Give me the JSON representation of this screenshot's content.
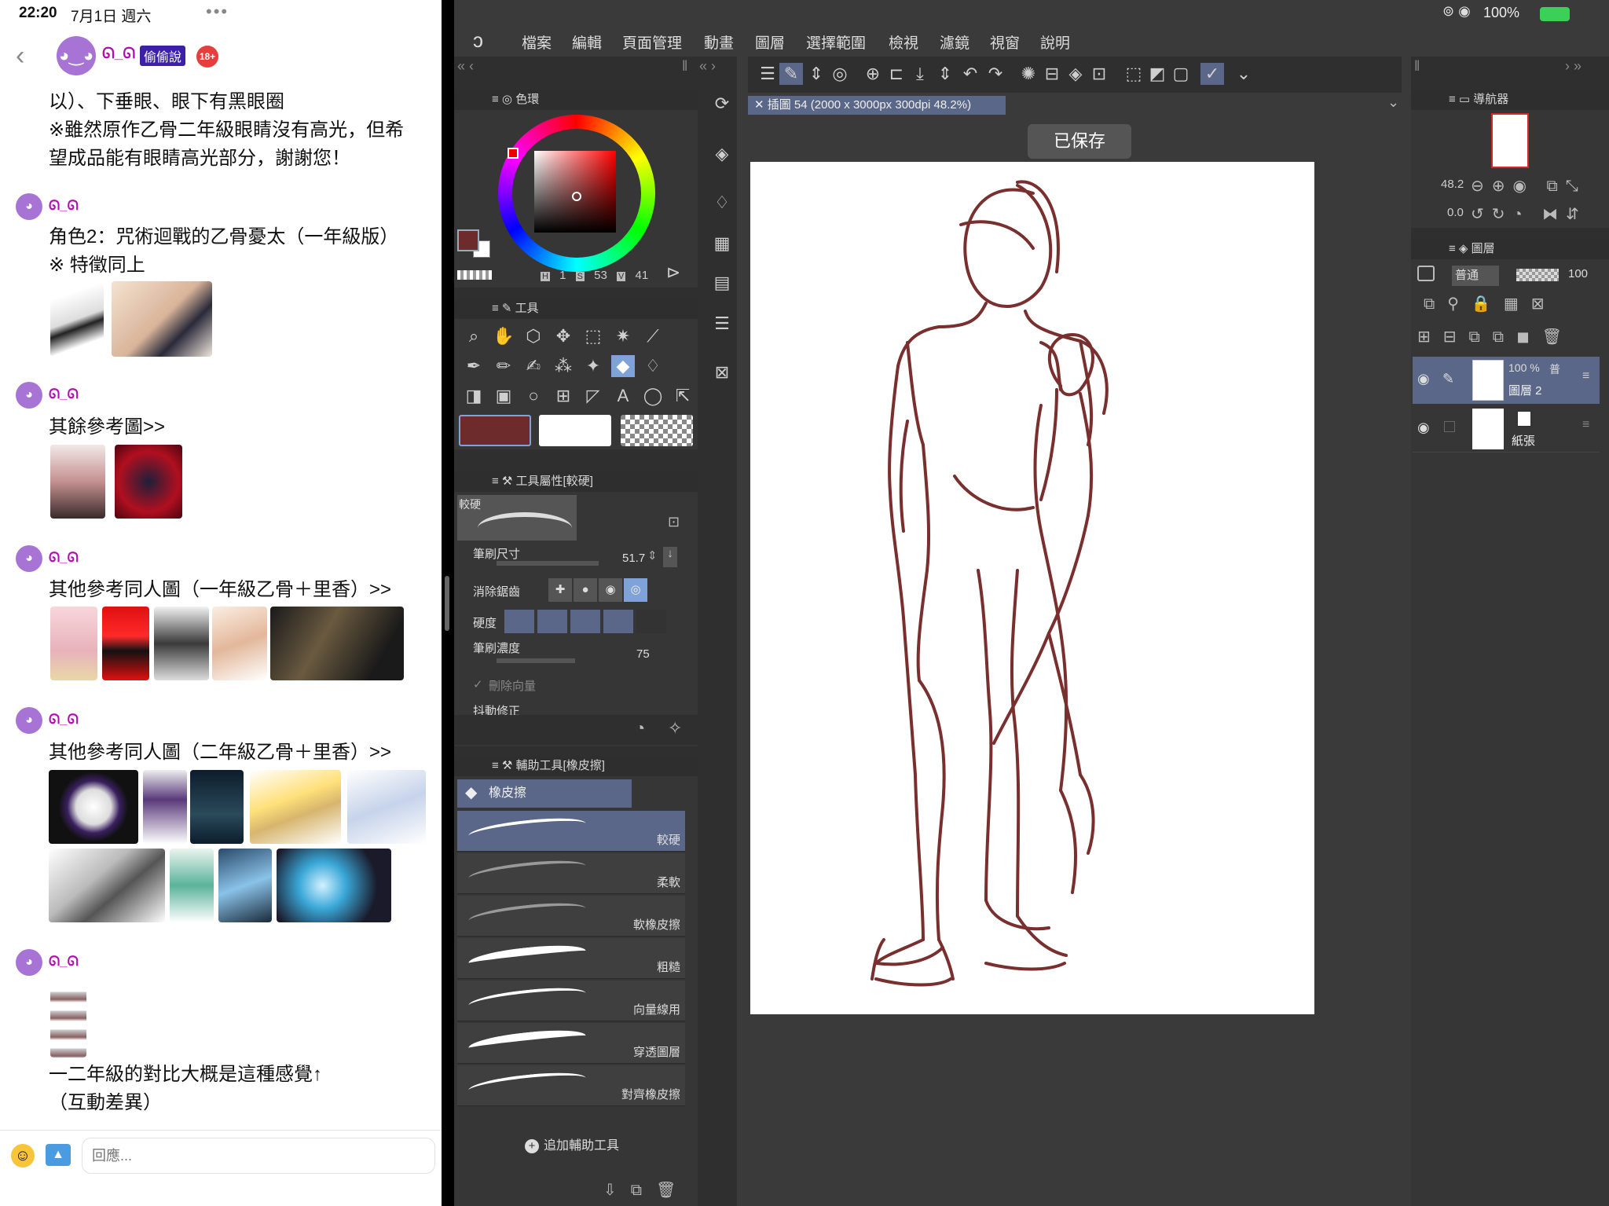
{
  "status_bar": {
    "time": "22:20",
    "date": "7月1日 週六",
    "dots": "•••",
    "battery": "100%"
  },
  "chat": {
    "header": {
      "name": "ᘏ_ᘏ",
      "tag": "偷偷說",
      "badge": "18+"
    },
    "intro_lines": [
      "以）、下垂眼、眼下有黑眼圈",
      "※雖然原作乙骨二年級眼睛沒有高光，但希",
      "望成品能有眼睛高光部分，謝謝您！"
    ],
    "messages": [
      {
        "user": "ᘏ_ᘏ",
        "lines": [
          "角色2：咒術迴戰的乙骨憂太（一年級版）",
          "※ 特徵同上"
        ]
      },
      {
        "user": "ᘏ_ᘏ",
        "lines": [
          "其餘參考圖>>"
        ]
      },
      {
        "user": "ᘏ_ᘏ",
        "lines": [
          "其他參考同人圖（一年級乙骨＋里香）>>"
        ]
      },
      {
        "user": "ᘏ_ᘏ",
        "lines": [
          "其他參考同人圖（二年級乙骨＋里香）>>"
        ]
      },
      {
        "user": "ᘏ_ᘏ",
        "lines": [
          "一二年級的對比大概是這種感覺↑",
          "（互動差異）"
        ]
      }
    ],
    "reply_placeholder": "回應..."
  },
  "app": {
    "menu": [
      "檔案",
      "編輯",
      "頁面管理",
      "動畫",
      "圖層",
      "選擇範圍",
      "檢視",
      "濾鏡",
      "視窗",
      "說明"
    ],
    "doc_tab": "插圖 54 (2000 x 3000px 300dpi 48.2%)",
    "saved_toast": "已保存",
    "color_panel": {
      "title": "色環",
      "h_label": "H",
      "h": "1",
      "s_label": "S",
      "s": "53",
      "v_label": "V",
      "v": "41",
      "main_color": "#6e2b2b",
      "sub_color": "#ffffff"
    },
    "tool_panel": {
      "title": "工具"
    },
    "tool_property": {
      "title": "工具屬性[較硬]",
      "preview_label": "較硬",
      "brush_size_label": "筆刷尺寸",
      "brush_size": "51.7",
      "antialias_label": "消除鋸齒",
      "hardness_label": "硬度",
      "density_label": "筆刷濃度",
      "density": "75",
      "delete_vector_label": "刪除向量",
      "stabilization_label": "抖動修正"
    },
    "subtool_panel": {
      "title": "輔助工具[橡皮擦]",
      "group": "橡皮擦",
      "items": [
        "較硬",
        "柔軟",
        "軟橡皮擦",
        "粗糙",
        "向量線用",
        "穿透圖層",
        "對齊橡皮擦"
      ],
      "add": "追加輔助工具"
    },
    "navigator": {
      "title": "導航器",
      "zoom": "48.2",
      "rotation": "0.0"
    },
    "layers": {
      "title": "圖層",
      "blend_mode": "普通",
      "opacity": "100",
      "items": [
        {
          "opacity": "100 %",
          "mode": "普",
          "name": "圖層 2"
        },
        {
          "name": "紙張"
        }
      ]
    }
  }
}
